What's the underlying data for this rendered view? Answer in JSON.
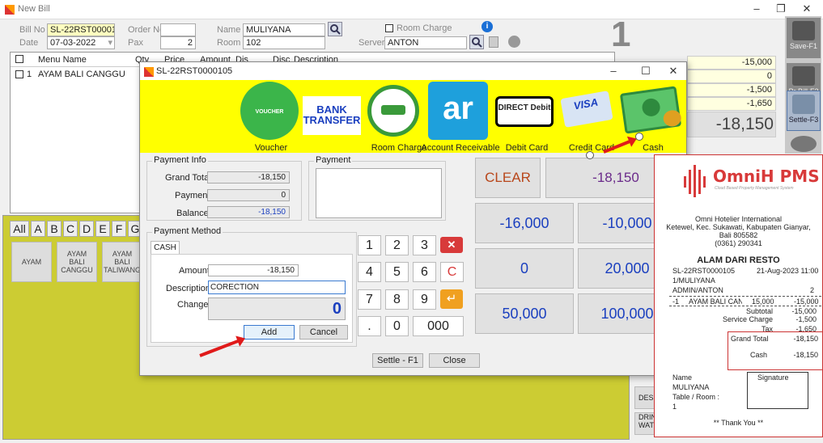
{
  "window": {
    "title": "New Bill",
    "controls": [
      "–",
      "❐",
      "✕"
    ]
  },
  "header": {
    "bill_no_label": "Bill No",
    "bill_no": "SL-22RST0000105",
    "date_label": "Date",
    "date": "07-03-2022",
    "order_no_label": "Order No",
    "order_no": "",
    "pax_label": "Pax",
    "pax": "2",
    "name_label": "Name",
    "name": "MULIYANA",
    "room_label": "Room",
    "room": "102",
    "room_charge_label": "Room Charge",
    "server_label": "Server",
    "server": "ANTON",
    "big_number": "1"
  },
  "grid": {
    "columns": [
      "Menu Name",
      "Qty",
      "Price",
      "Amount",
      "Dis",
      "Disc",
      "Description"
    ],
    "rows": [
      {
        "no": "1",
        "menu": "AYAM BALI CANGGU"
      }
    ]
  },
  "categories": {
    "letters": [
      "All",
      "A",
      "B",
      "C",
      "D",
      "E",
      "F",
      "G"
    ],
    "items": [
      "AYAM",
      "AYAM BALI CANGGU",
      "AYAM BALI TALIWANG"
    ]
  },
  "summary": {
    "values": [
      "-15,000",
      "0",
      "-1,500",
      "-1,650"
    ],
    "total": "-18,150"
  },
  "side_buttons": [
    "Save-F1",
    "Pr Bill-F2",
    "Settle-F3"
  ],
  "dialog": {
    "title": "SL-22RST0000105",
    "payment_methods": [
      {
        "label": "Voucher",
        "icon": "voucher-icon",
        "logo_text": "VOUCHER"
      },
      {
        "label": "",
        "icon": "bank-transfer-icon",
        "logo_text": "BANK TRANSFER"
      },
      {
        "label": "Room Charge",
        "icon": "bed-icon",
        "logo_text": ""
      },
      {
        "label": "Account Receivable",
        "icon": "ar-icon",
        "logo_text": "ar"
      },
      {
        "label": "Debit Card",
        "icon": "direct-debit-icon",
        "logo_text": "DIRECT Debit"
      },
      {
        "label": "Credit Card",
        "icon": "credit-card-icon",
        "logo_text": "VISA"
      },
      {
        "label": "Cash",
        "icon": "cash-icon",
        "logo_text": ""
      }
    ],
    "payment_info": {
      "title": "Payment Info",
      "grand_total_label": "Grand Total",
      "grand_total": "-18,150",
      "payment_label": "Payment",
      "payment": "0",
      "balance_label": "Balance",
      "balance": "-18,150"
    },
    "payment_group_title": "Payment",
    "payment_method": {
      "title": "Payment Method",
      "tab": "CASH",
      "amount_label": "Amount",
      "amount": "-18,150",
      "description_label": "Description",
      "description": "CORECTION",
      "change_label": "Change",
      "change": "0"
    },
    "keypad": [
      "1",
      "2",
      "3",
      "4",
      "5",
      "6",
      "7",
      "8",
      "9",
      ".",
      "0",
      "000"
    ],
    "add_label": "Add",
    "cancel_label": "Cancel",
    "clear_label": "CLEAR",
    "total_display": "-18,150",
    "amounts": [
      "-16,000",
      "-10,000",
      "0",
      "20,000",
      "50,000",
      "100,000"
    ],
    "settle_label": "Settle - F1",
    "close_label": "Close"
  },
  "lower_right_buttons": [
    "DESS",
    "DRIN WAT"
  ],
  "receipt": {
    "brand": "OmniH PMS",
    "tagline": "Cloud Based Property Management System",
    "company": "Omni Hotelier International",
    "address1": "Ketewel, Kec. Sukawati, Kabupaten Gianyar,",
    "address2": "Bali 805582",
    "phone": "(0361) 290341",
    "outlet": "ALAM DARI RESTO",
    "bill_no": "SL-22RST0000105",
    "datetime": "21-Aug-2023  11:00",
    "table_guest": "1/MULIYANA",
    "admin": "ADMIN/ANTON",
    "pax": "2",
    "item_line": {
      "qty": "-1",
      "name": "AYAM BALI CAN",
      "price": "15,000",
      "amount": "-15,000"
    },
    "subtotal_label": "Subtotal",
    "subtotal": "-15,000",
    "service_label": "Service Charge",
    "service": "-1,500",
    "tax_label": "Tax",
    "tax": "-1,650",
    "grand_total_label": "Grand Total",
    "grand_total": "-18,150",
    "cash_label": "Cash",
    "cash": "-18,150",
    "name_label": "Name",
    "name": "MULIYANA",
    "table_room_label": "Table / Room :",
    "table_room": "1",
    "signature_label": "Signature",
    "footer": "** Thank You **"
  },
  "colors": {
    "banner": "#ffff00",
    "amount_text": "#1a3fbf",
    "clear_text": "#b8461a",
    "arrow": "#e01a1a",
    "category_bg": "#cccc33"
  }
}
